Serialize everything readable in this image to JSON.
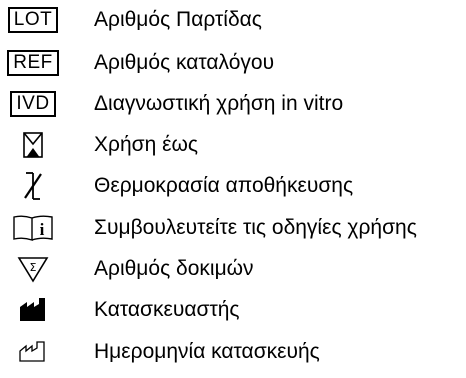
{
  "symbols": [
    {
      "icon": "lot-symbol",
      "symbol_text": "LOT",
      "label": "Αριθμός Παρτίδας"
    },
    {
      "icon": "ref-symbol",
      "symbol_text": "REF",
      "label": "Αριθμός καταλόγου"
    },
    {
      "icon": "ivd-symbol",
      "symbol_text": "IVD",
      "label": "Διαγνωστική χρήση in vitro"
    },
    {
      "icon": "hourglass-icon",
      "label": "Χρήση έως"
    },
    {
      "icon": "thermometer-icon",
      "label": "Θερμοκρασία αποθήκευσης"
    },
    {
      "icon": "book-info-icon",
      "label": "Συμβουλευτείτε τις οδηγίες χρήσης"
    },
    {
      "icon": "sigma-triangle-icon",
      "label": "Αριθμός δοκιμών"
    },
    {
      "icon": "factory-icon",
      "label": "Κατασκευαστής"
    },
    {
      "icon": "manufacture-date-icon",
      "label": "Ημερομηνία κατασκευής"
    }
  ]
}
